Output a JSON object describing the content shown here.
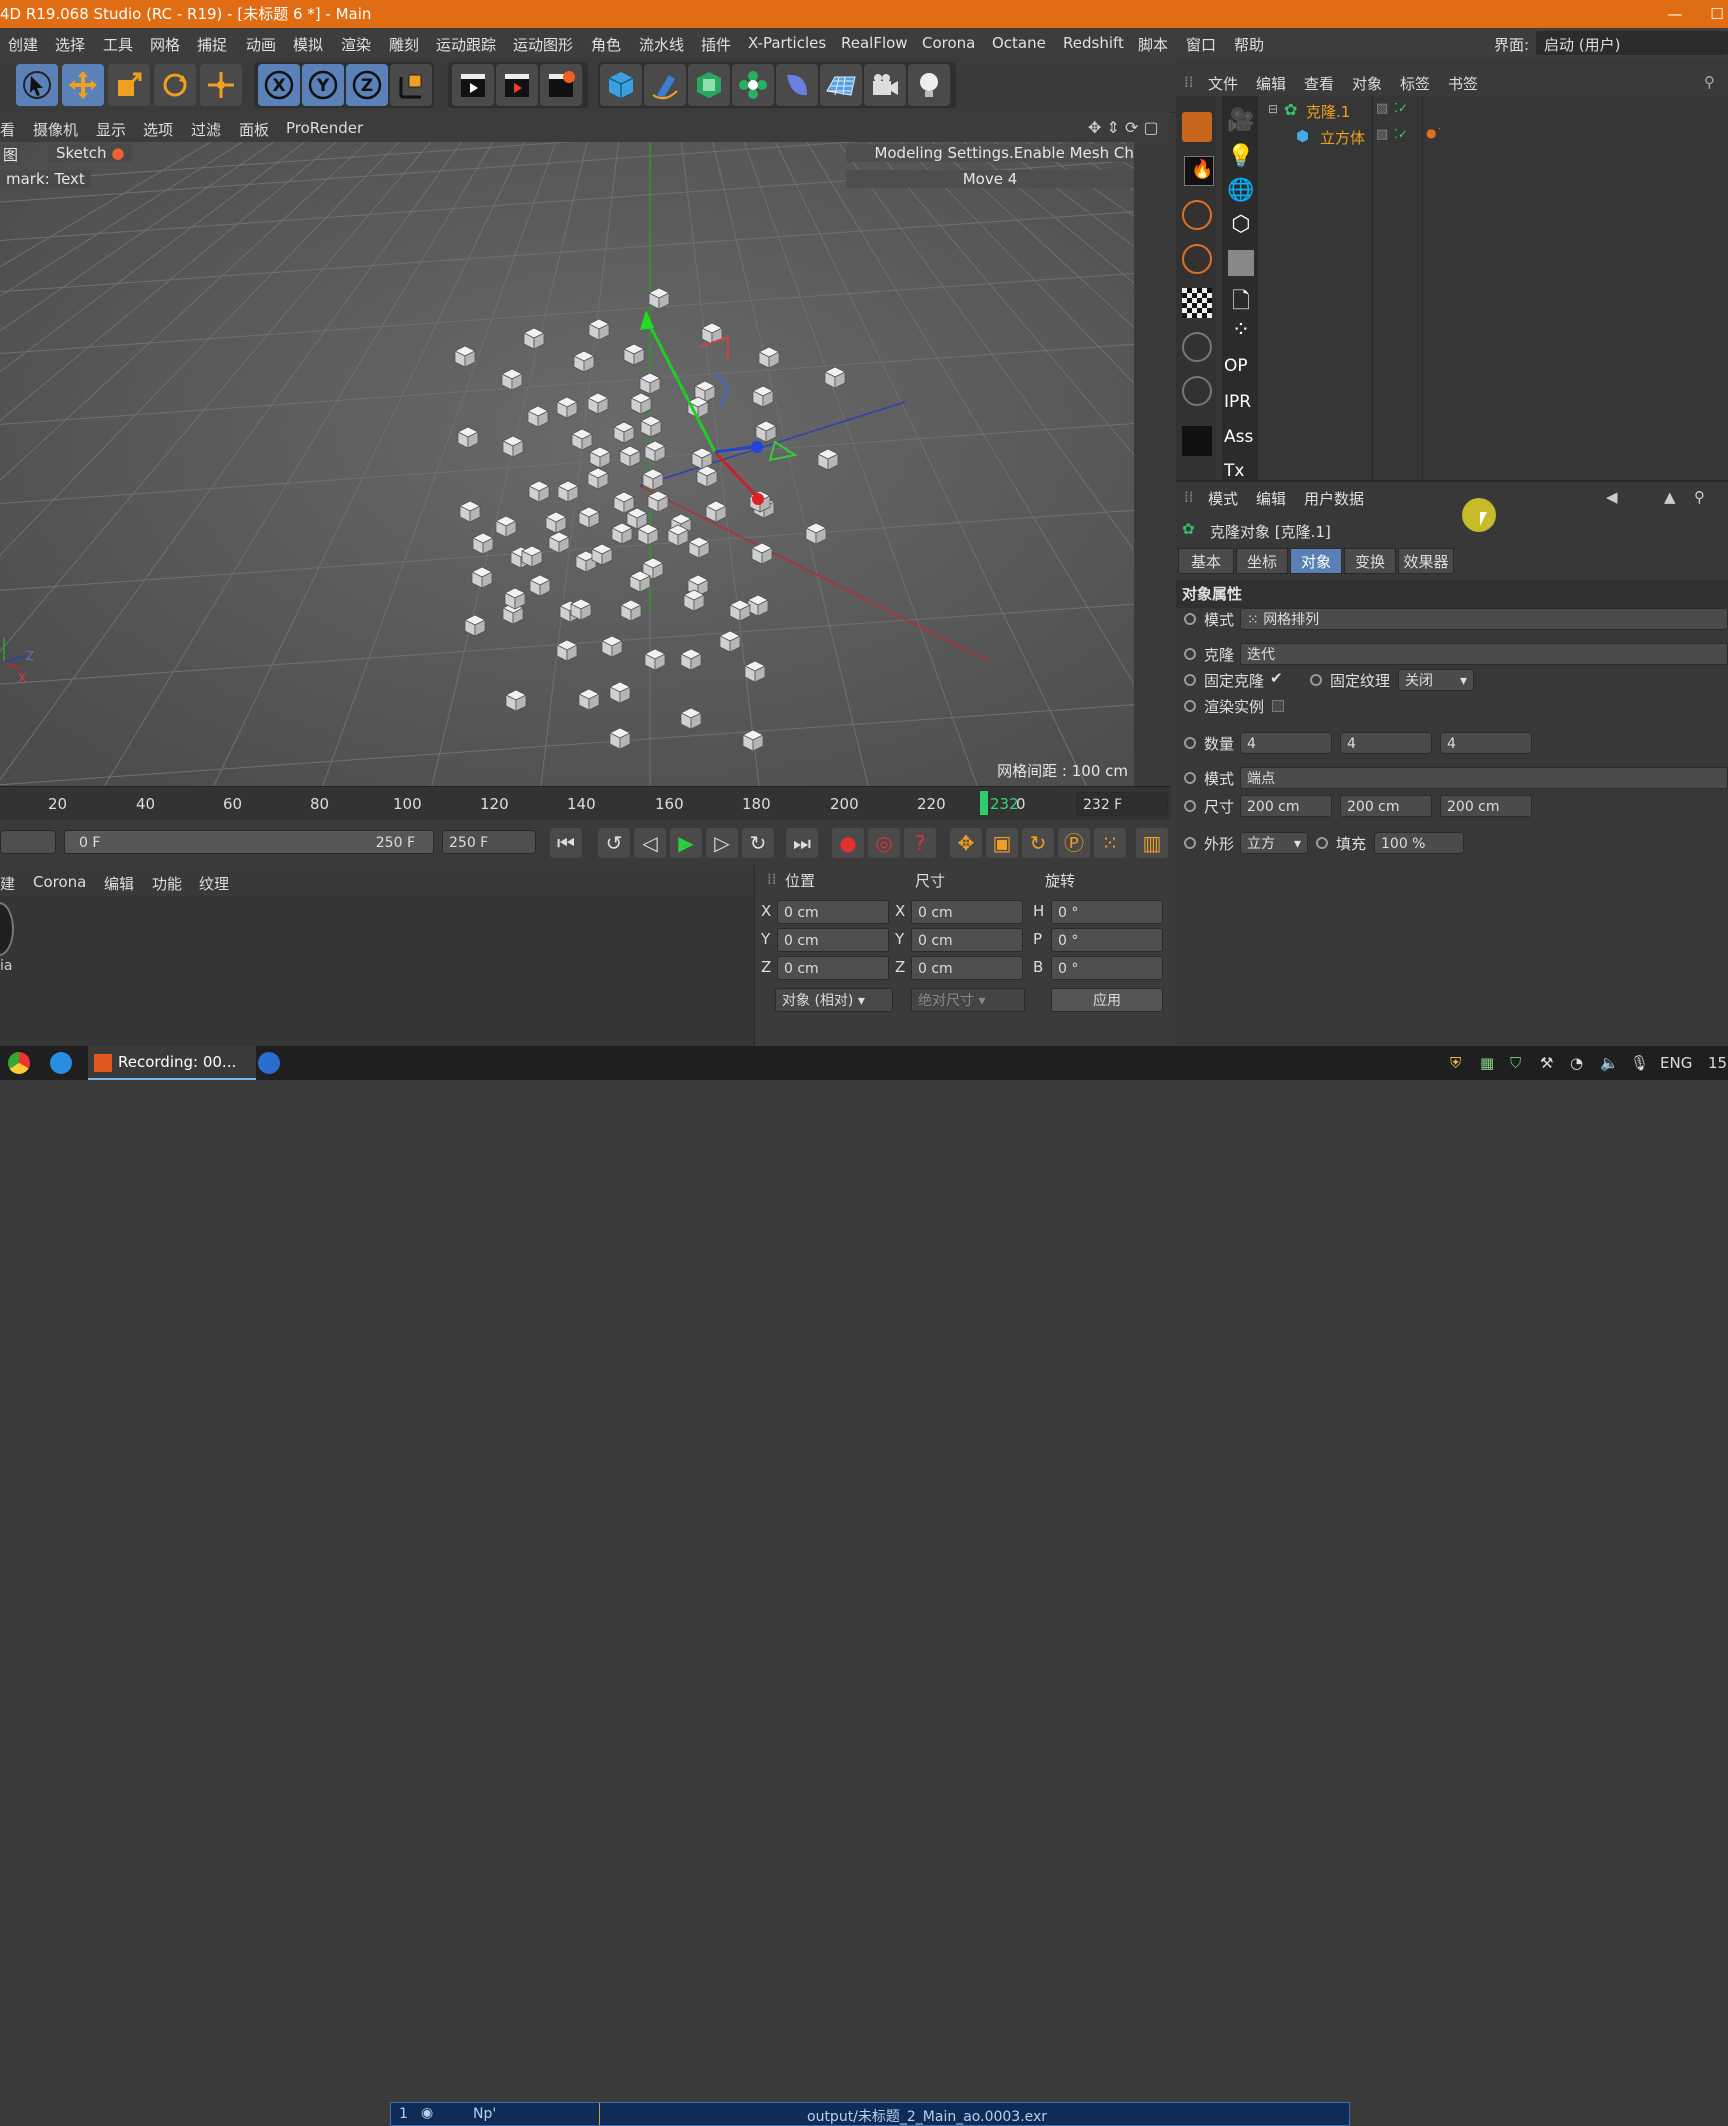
{
  "window": {
    "title": "4D R19.068 Studio (RC - R19) - [未标题 6 *] - Main"
  },
  "menubar": {
    "items": [
      "创建",
      "选择",
      "工具",
      "网格",
      "捕捉",
      "动画",
      "模拟",
      "渲染",
      "雕刻",
      "运动跟踪",
      "运动图形",
      "角色",
      "流水线",
      "插件",
      "X-Particles",
      "RealFlow",
      "Corona",
      "Octane",
      "Redshift",
      "脚本",
      "窗口",
      "帮助"
    ],
    "layout_label": "界面:",
    "layout_value": "启动 (用户)"
  },
  "viewport": {
    "menu": [
      "看",
      "摄像机",
      "显示",
      "选项",
      "过滤",
      "面板",
      "ProRender"
    ],
    "tab_left": "图",
    "tab_sketch": "Sketch",
    "watermark": "mark: Text",
    "hud_line1": "Modeling Settings.Enable Mesh Check",
    "hud_line2": "Move 4",
    "grid_spacing": "网格间距 : 100 cm"
  },
  "timeline": {
    "ticks": [
      "20",
      "40",
      "60",
      "80",
      "100",
      "120",
      "140",
      "160",
      "180",
      "200",
      "220"
    ],
    "current_frame_label": "232",
    "current_frame_suffix": "0",
    "current_frame_field": "232 F",
    "range_start": "0 F",
    "range_end": "250 F",
    "end_field": "250 F"
  },
  "material_manager": {
    "menu": [
      "建",
      "Corona",
      "编辑",
      "功能",
      "纹理"
    ],
    "thumb_label": "ia"
  },
  "coordinates": {
    "headers": {
      "position": "位置",
      "size": "尺寸",
      "rotation": "旋转"
    },
    "rows": [
      {
        "axis": "X",
        "pos": "0 cm",
        "size_axis": "X",
        "size": "0 cm",
        "rot_axis": "H",
        "rot": "0 °"
      },
      {
        "axis": "Y",
        "pos": "0 cm",
        "size_axis": "Y",
        "size": "0 cm",
        "rot_axis": "P",
        "rot": "0 °"
      },
      {
        "axis": "Z",
        "pos": "0 cm",
        "size_axis": "Z",
        "size": "0 cm",
        "rot_axis": "B",
        "rot": "0 °"
      }
    ],
    "mode_select": "对象 (相对)",
    "size_select": "绝对尺寸",
    "apply_label": "应用"
  },
  "object_manager": {
    "menu": [
      "文件",
      "编辑",
      "查看",
      "对象",
      "标签",
      "书签"
    ],
    "objects": [
      {
        "name": "克隆.1",
        "icon": "cloner-icon"
      },
      {
        "name": "立方体",
        "icon": "cube-icon"
      }
    ],
    "icon_labels": [
      "OP",
      "IPR",
      "Ass",
      "Tx"
    ]
  },
  "attribute_manager": {
    "menu": [
      "模式",
      "编辑",
      "用户数据"
    ],
    "object_title": "克隆对象 [克隆.1]",
    "tabs": [
      "基本",
      "坐标",
      "对象",
      "变换",
      "效果器"
    ],
    "active_tab": "对象",
    "section": "对象属性",
    "mode_label": "模式",
    "mode_value": "网格排列",
    "clones_label": "克隆",
    "clones_value": "迭代",
    "fix_clone_label": "固定克隆",
    "fix_clone_check": "✔",
    "fix_texture_label": "固定纹理",
    "fix_texture_value": "关闭",
    "render_instances_label": "渲染实例",
    "count_label": "数量",
    "count_values": [
      "4",
      "4",
      "4"
    ],
    "mode2_label": "模式",
    "mode2_value": "端点",
    "size_label": "尺寸",
    "size_values": [
      "200 cm",
      "200 cm",
      "200 cm"
    ],
    "shape_label": "外形",
    "shape_value": "立方",
    "fill_label": "填充",
    "fill_value": "100 %"
  },
  "taskbar": {
    "recording_label": "Recording: 00...",
    "status_index": "1",
    "status_np": "Np'",
    "status_output": "output/未标题_2_Main_ao.0003.exr",
    "lang": "ENG",
    "clock": "15"
  }
}
